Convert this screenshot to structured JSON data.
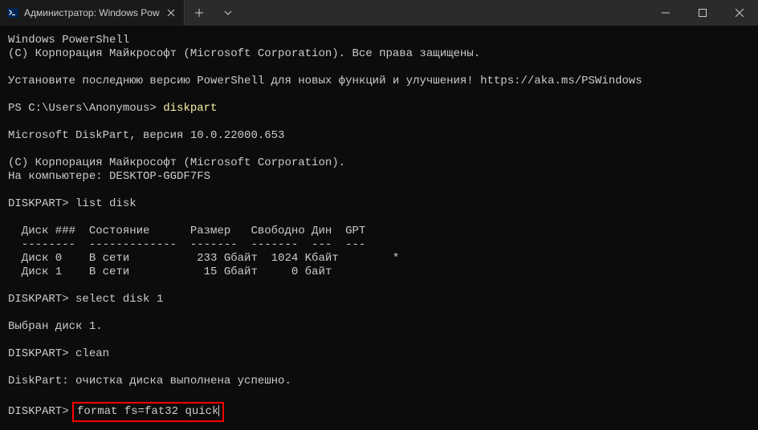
{
  "titlebar": {
    "tab_title": "Администратор: Windows Pow"
  },
  "terminal": {
    "line1": "Windows PowerShell",
    "line2": "(C) Корпорация Майкрософт (Microsoft Corporation). Все права защищены.",
    "line3": "Установите последнюю версию PowerShell для новых функций и улучшения! https://aka.ms/PSWindows",
    "prompt1": "PS C:\\Users\\Anonymous> ",
    "cmd1": "diskpart",
    "line4": "Microsoft DiskPart, версия 10.0.22000.653",
    "line5": "(C) Корпорация Майкрософт (Microsoft Corporation).",
    "line6": "На компьютере: DESKTOP-GGDF7FS",
    "prompt2": "DISKPART> ",
    "cmd2": "list disk",
    "table_header": "  Диск ###  Состояние      Размер   Свободно Дин  GPT",
    "table_divider": "  --------  -------------  -------  -------  ---  ---",
    "table_row1": "  Диск 0    В сети          233 Gбайт  1024 Kбайт        *",
    "table_row2": "  Диск 1    В сети           15 Gбайт     0 байт",
    "prompt3": "DISKPART> ",
    "cmd3": "select disk 1",
    "line7": "Выбран диск 1.",
    "prompt4": "DISKPART> ",
    "cmd4": "clean",
    "line8": "DiskPart: очистка диска выполнена успешно.",
    "prompt5": "DISKPART> ",
    "cmd5": "format fs=fat32 quick"
  }
}
